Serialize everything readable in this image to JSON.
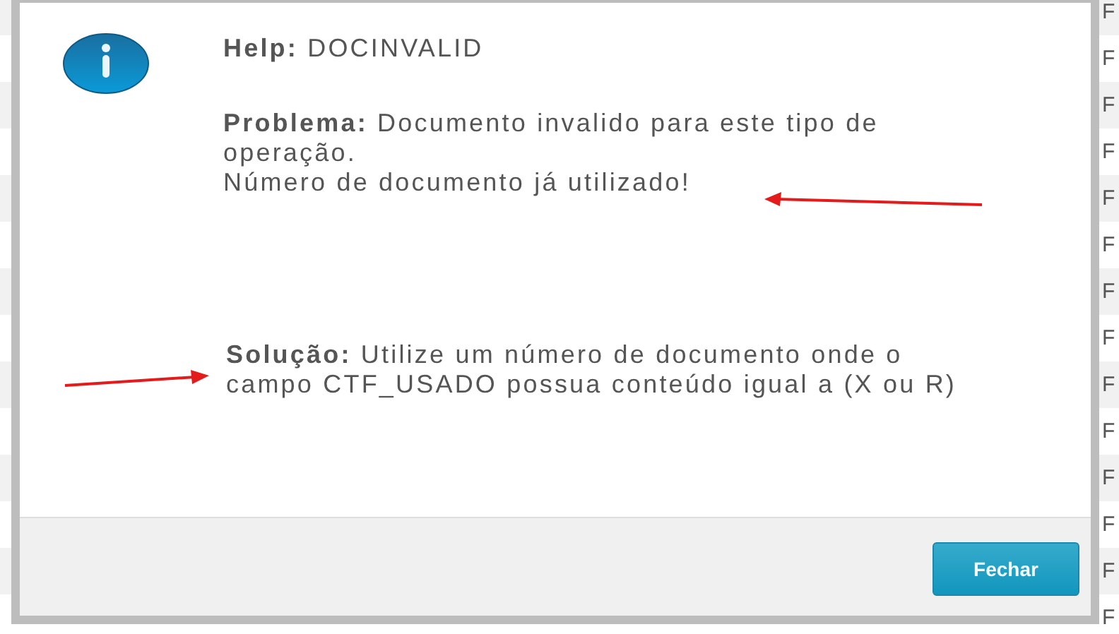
{
  "background_rows": [
    "F",
    "F",
    "F",
    "F",
    "F",
    "F",
    "F",
    "F",
    "F",
    "F",
    "F",
    "F",
    "F",
    "F"
  ],
  "dialog": {
    "help": {
      "label": "Help:",
      "value": "DOCINVALID"
    },
    "problem": {
      "label": "Problema:",
      "lines": [
        "Documento invalido para este tipo de operação.",
        "Número de documento já utilizado!"
      ]
    },
    "solution": {
      "label": "Solução:",
      "text": "Utilize um número de documento onde o campo CTF_USADO possua conteúdo igual a (X ou R)"
    },
    "buttons": [
      "Fechar"
    ]
  }
}
